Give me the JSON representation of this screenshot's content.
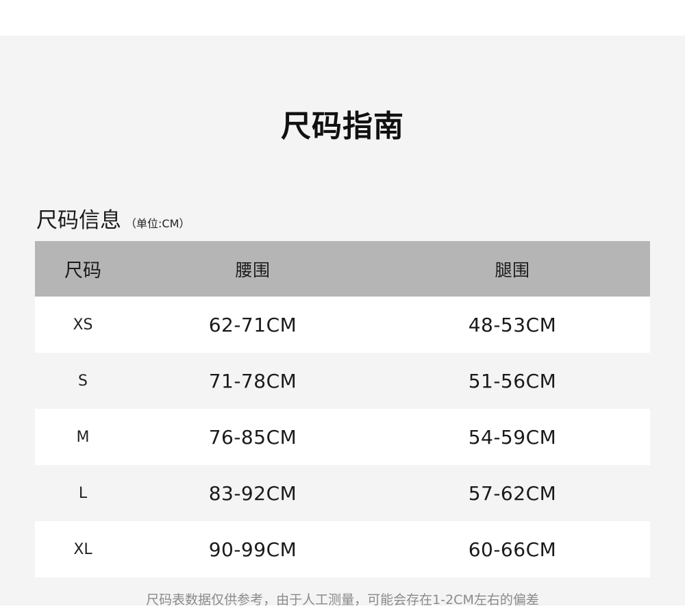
{
  "title": "尺码指南",
  "section": {
    "label": "尺码信息",
    "unit": "（单位:CM）"
  },
  "table": {
    "headers": [
      "尺码",
      "腰围",
      "腿围"
    ],
    "rows": [
      [
        "XS",
        "62-71CM",
        "48-53CM"
      ],
      [
        "S",
        "71-78CM",
        "51-56CM"
      ],
      [
        "M",
        "76-85CM",
        "54-59CM"
      ],
      [
        "L",
        "83-92CM",
        "57-62CM"
      ],
      [
        "XL",
        "90-99CM",
        "60-66CM"
      ]
    ]
  },
  "note": "尺码表数据仅供参考，由于人工测量，可能会存在1-2CM左右的偏差"
}
